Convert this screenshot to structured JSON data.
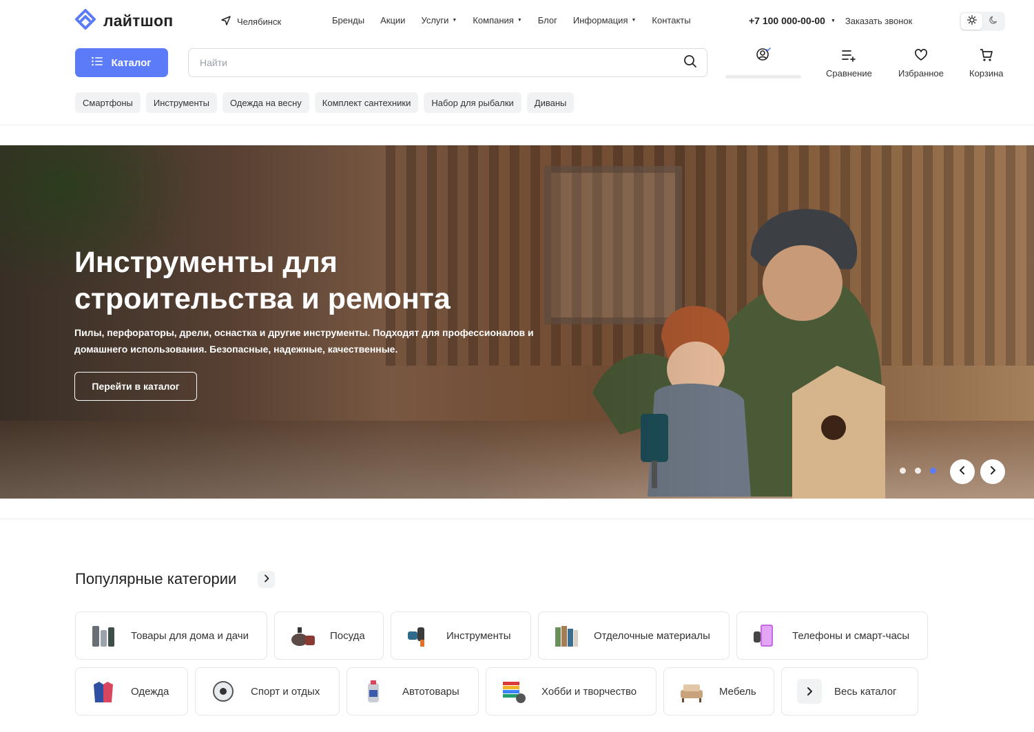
{
  "header": {
    "logo_text": "лайтшоп",
    "city": "Челябинск",
    "nav": [
      {
        "label": "Бренды"
      },
      {
        "label": "Акции"
      },
      {
        "label": "Услуги",
        "has_dropdown": true
      },
      {
        "label": "Компания",
        "has_dropdown": true
      },
      {
        "label": "Блог"
      },
      {
        "label": "Информация",
        "has_dropdown": true
      },
      {
        "label": "Контакты"
      }
    ],
    "phone": "+7 100 000-00-00",
    "callback_label": "Заказать звонок",
    "theme": {
      "active": "light"
    }
  },
  "search_row": {
    "catalog_label": "Каталог",
    "search_placeholder": "Найти",
    "compare_label": "Сравнение",
    "favorites_label": "Избранное",
    "cart_label": "Корзина"
  },
  "tags": [
    "Смартфоны",
    "Инструменты",
    "Одежда на весну",
    "Комплект сантехники",
    "Набор для рыбалки",
    "Диваны"
  ],
  "banner": {
    "title": "Инструменты для строительства и ремонта",
    "description": "Пилы, перфораторы, дрели, оснастка и другие инструменты. Подходят для профессионалов и домашнего использования. Безопасные, надежные, качественные.",
    "button_label": "Перейти в каталог",
    "slides_count": 3,
    "active_slide": 3
  },
  "popular": {
    "title": "Популярные категории",
    "row1": [
      {
        "label": "Товары для дома и дачи",
        "icon": "home-garden-icon"
      },
      {
        "label": "Посуда",
        "icon": "cookware-icon"
      },
      {
        "label": "Инструменты",
        "icon": "tools-icon"
      },
      {
        "label": "Отделочные материалы",
        "icon": "materials-icon"
      },
      {
        "label": "Телефоны и смарт-часы",
        "icon": "phones-icon"
      }
    ],
    "row2": [
      {
        "label": "Одежда",
        "icon": "clothes-icon"
      },
      {
        "label": "Спорт и отдых",
        "icon": "sport-icon"
      },
      {
        "label": "Автотовары",
        "icon": "auto-icon"
      },
      {
        "label": "Хобби и творчество",
        "icon": "hobby-icon"
      },
      {
        "label": "Мебель",
        "icon": "furniture-icon"
      }
    ],
    "all_catalog_label": "Весь каталог"
  },
  "colors": {
    "accent": "#5b7cf6",
    "tag_bg": "#f1f2f4",
    "border": "#e4e5e8"
  }
}
